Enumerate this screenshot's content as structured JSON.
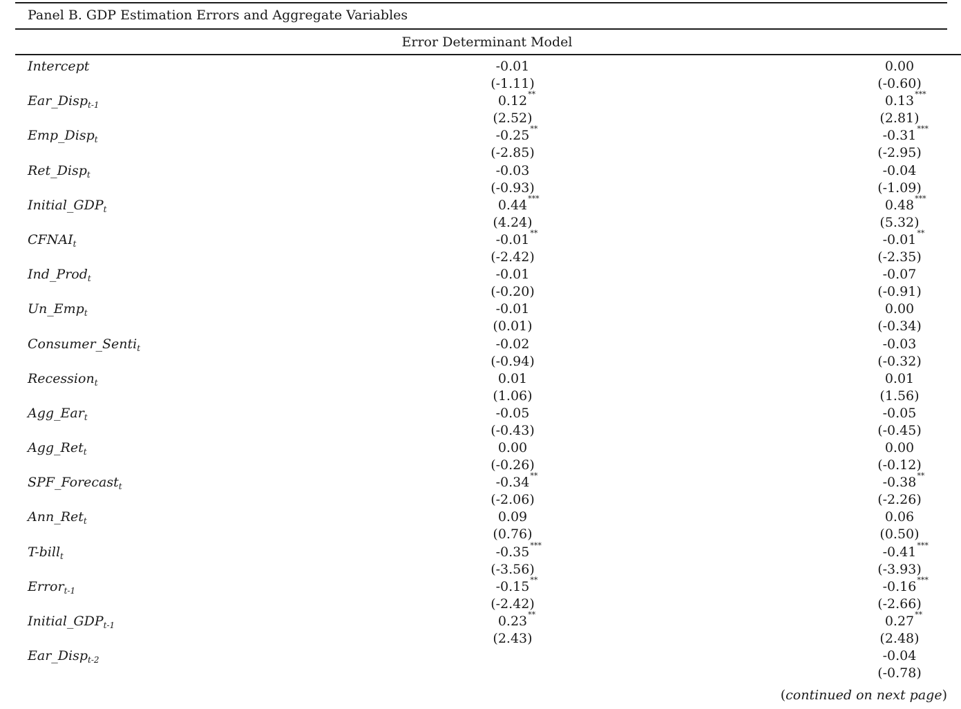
{
  "panel_title": "Panel B. GDP Estimation Errors and Aggregate Variables",
  "model_title": "Error Determinant Model",
  "rows": [
    {
      "base": "Intercept",
      "sub": "",
      "c1": "-0.01",
      "s1": "",
      "t1": "(-1.11)",
      "c2": "0.00",
      "s2": "",
      "t2": "(-0.60)"
    },
    {
      "base": "Ear_Disp",
      "sub": "t-1",
      "c1": "0.12",
      "s1": "**",
      "t1": "(2.52)",
      "c2": "0.13",
      "s2": "***",
      "t2": "(2.81)"
    },
    {
      "base": "Emp_Disp",
      "sub": "t",
      "c1": "-0.25",
      "s1": "**",
      "t1": "(-2.85)",
      "c2": "-0.31",
      "s2": "***",
      "t2": "(-2.95)"
    },
    {
      "base": "Ret_Disp",
      "sub": "t",
      "c1": "-0.03",
      "s1": "",
      "t1": "(-0.93)",
      "c2": "-0.04",
      "s2": "",
      "t2": "(-1.09)"
    },
    {
      "base": "Initial_GDP",
      "sub": "t",
      "c1": "0.44",
      "s1": "***",
      "t1": "(4.24)",
      "c2": "0.48",
      "s2": "***",
      "t2": "(5.32)"
    },
    {
      "base": "CFNAI",
      "sub": "t",
      "c1": "-0.01",
      "s1": "**",
      "t1": "(-2.42)",
      "c2": "-0.01",
      "s2": "**",
      "t2": "(-2.35)"
    },
    {
      "base": "Ind_Prod",
      "sub": "t",
      "c1": "-0.01",
      "s1": "",
      "t1": "(-0.20)",
      "c2": "-0.07",
      "s2": "",
      "t2": "(-0.91)"
    },
    {
      "base": "Un_Emp",
      "sub": "t",
      "c1": "-0.01",
      "s1": "",
      "t1": "(0.01)",
      "c2": "0.00",
      "s2": "",
      "t2": "(-0.34)"
    },
    {
      "base": "Consumer_Senti",
      "sub": "t",
      "c1": "-0.02",
      "s1": "",
      "t1": "(-0.94)",
      "c2": "-0.03",
      "s2": "",
      "t2": "(-0.32)"
    },
    {
      "base": "Recession",
      "sub": "t",
      "c1": "0.01",
      "s1": "",
      "t1": "(1.06)",
      "c2": "0.01",
      "s2": "",
      "t2": "(1.56)"
    },
    {
      "base": "Agg_Ear",
      "sub": "t",
      "c1": "-0.05",
      "s1": "",
      "t1": "(-0.43)",
      "c2": "-0.05",
      "s2": "",
      "t2": "(-0.45)"
    },
    {
      "base": "Agg_Ret",
      "sub": "t",
      "c1": "0.00",
      "s1": "",
      "t1": "(-0.26)",
      "c2": "0.00",
      "s2": "",
      "t2": "(-0.12)"
    },
    {
      "base": "SPF_Forecast",
      "sub": "t",
      "c1": "-0.34",
      "s1": "**",
      "t1": "(-2.06)",
      "c2": "-0.38",
      "s2": "**",
      "t2": "(-2.26)"
    },
    {
      "base": "Ann_Ret",
      "sub": "t",
      "c1": "0.09",
      "s1": "",
      "t1": "(0.76)",
      "c2": "0.06",
      "s2": "",
      "t2": "(0.50)"
    },
    {
      "base": "T-bill",
      "sub": "t",
      "c1": "-0.35",
      "s1": "***",
      "t1": "(-3.56)",
      "c2": "-0.41",
      "s2": "***",
      "t2": "(-3.93)"
    },
    {
      "base": "Error",
      "sub": "t-1",
      "c1": "-0.15",
      "s1": "**",
      "t1": "(-2.42)",
      "c2": "-0.16",
      "s2": "***",
      "t2": "(-2.66)"
    },
    {
      "base": "Initial_GDP",
      "sub": "t-1",
      "c1": "0.23",
      "s1": "**",
      "t1": "(2.43)",
      "c2": "0.27",
      "s2": "**",
      "t2": "(2.48)"
    },
    {
      "base": "Ear_Disp",
      "sub": "t-2",
      "c1": "",
      "s1": "",
      "t1": "",
      "c2": "-0.04",
      "s2": "",
      "t2": "(-0.78)"
    }
  ],
  "footer": {
    "open": "(",
    "text": "continued on next page",
    "close": ")"
  }
}
